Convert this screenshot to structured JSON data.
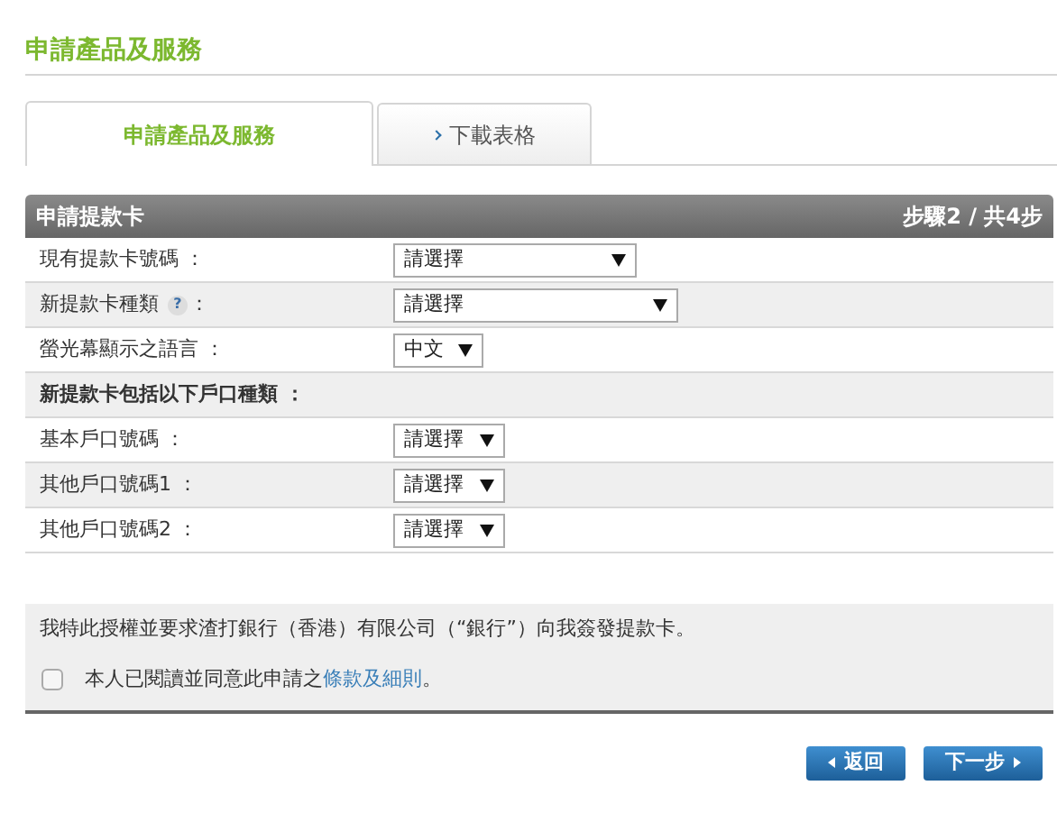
{
  "page_title": "申請產品及服務",
  "tabs": [
    {
      "label": "申請產品及服務",
      "selected": true
    },
    {
      "label": "下載表格",
      "selected": false
    }
  ],
  "panel": {
    "title": "申請提款卡",
    "step": "步驟2 / 共4步"
  },
  "rows": [
    {
      "kind": "select",
      "label": "現有提款卡號碼 ：",
      "value": "請選擇"
    },
    {
      "kind": "select",
      "label": "新提款卡種類",
      "help_icon": "?",
      "suffix": "：",
      "value": "請選擇"
    },
    {
      "kind": "select",
      "label": "螢光幕顯示之語言 ：",
      "value": "中文"
    },
    {
      "kind": "section",
      "label": "新提款卡包括以下戶口種類 ："
    },
    {
      "kind": "select",
      "label": "基本戶口號碼 ：",
      "value": "請選擇"
    },
    {
      "kind": "select",
      "label": "其他戶口號碼1 ：",
      "value": "請選擇"
    },
    {
      "kind": "select",
      "label": "其他戶口號碼2 ：",
      "value": "請選擇"
    }
  ],
  "authorization": "我特此授權並要求渣打銀行（香港）有限公司（“銀行”）向我簽發提款卡。",
  "agreement": {
    "checked": false,
    "text": "本人已閱讀並同意此申請之",
    "link": "條款及細則",
    "end": "。"
  },
  "buttons": [
    {
      "kind": "back",
      "label": "返回"
    },
    {
      "kind": "next",
      "label": "下一步"
    }
  ]
}
